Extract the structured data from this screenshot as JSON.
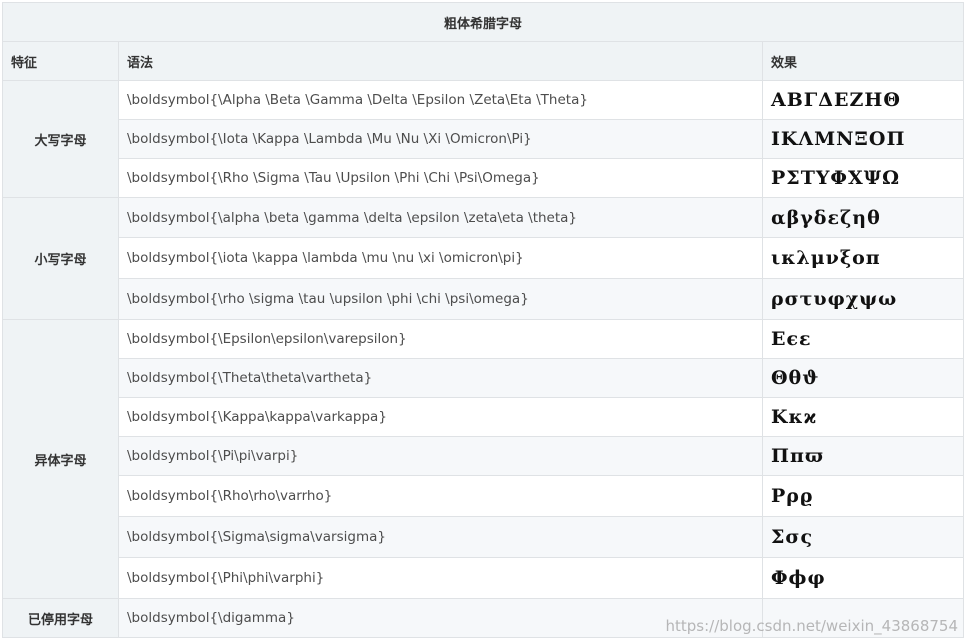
{
  "table": {
    "caption": "粗体希腊字母",
    "headers": {
      "feature": "特征",
      "syntax": "语法",
      "effect": "效果"
    },
    "groups": [
      {
        "feature": "大写字母",
        "rows": [
          {
            "syntax": "\\boldsymbol{\\Alpha \\Beta \\Gamma \\Delta \\Epsilon \\Zeta\\Eta \\Theta}",
            "effect": "ΑΒΓΔΕΖΗΘ"
          },
          {
            "syntax": "\\boldsymbol{\\Iota \\Kappa \\Lambda \\Mu \\Nu \\Xi \\Omicron\\Pi}",
            "effect": "ΙΚΛΜΝΞΟΠ"
          },
          {
            "syntax": "\\boldsymbol{\\Rho \\Sigma \\Tau \\Upsilon \\Phi \\Chi \\Psi\\Omega}",
            "effect": "ΡΣΤΥΦΧΨΩ"
          }
        ]
      },
      {
        "feature": "小写字母",
        "rows": [
          {
            "syntax": "\\boldsymbol{\\alpha \\beta \\gamma \\delta \\epsilon \\zeta\\eta \\theta}",
            "effect": "αβγδεζηθ"
          },
          {
            "syntax": "\\boldsymbol{\\iota \\kappa \\lambda \\mu \\nu \\xi \\omicron\\pi}",
            "effect": "ικλμνξοπ"
          },
          {
            "syntax": "\\boldsymbol{\\rho \\sigma \\tau \\upsilon \\phi \\chi \\psi\\omega}",
            "effect": "ρστυφχψω"
          }
        ]
      },
      {
        "feature": "异体字母",
        "rows": [
          {
            "syntax": "\\boldsymbol{\\Epsilon\\epsilon\\varepsilon}",
            "effect": "Εϵε"
          },
          {
            "syntax": "\\boldsymbol{\\Theta\\theta\\vartheta}",
            "effect": "Θθϑ"
          },
          {
            "syntax": "\\boldsymbol{\\Kappa\\kappa\\varkappa}",
            "effect": "Κκϰ"
          },
          {
            "syntax": "\\boldsymbol{\\Pi\\pi\\varpi}",
            "effect": "Ππϖ"
          },
          {
            "syntax": "\\boldsymbol{\\Rho\\rho\\varrho}",
            "effect": "Ρρϱ"
          },
          {
            "syntax": "\\boldsymbol{\\Sigma\\sigma\\varsigma}",
            "effect": "Σσς"
          },
          {
            "syntax": "\\boldsymbol{\\Phi\\phi\\varphi}",
            "effect": "Φϕφ"
          }
        ]
      },
      {
        "feature": "已停用字母",
        "rows": [
          {
            "syntax": "\\boldsymbol{\\digamma}",
            "effect": ""
          }
        ]
      }
    ]
  },
  "watermark": "https://blog.csdn.net/weixin_43868754"
}
